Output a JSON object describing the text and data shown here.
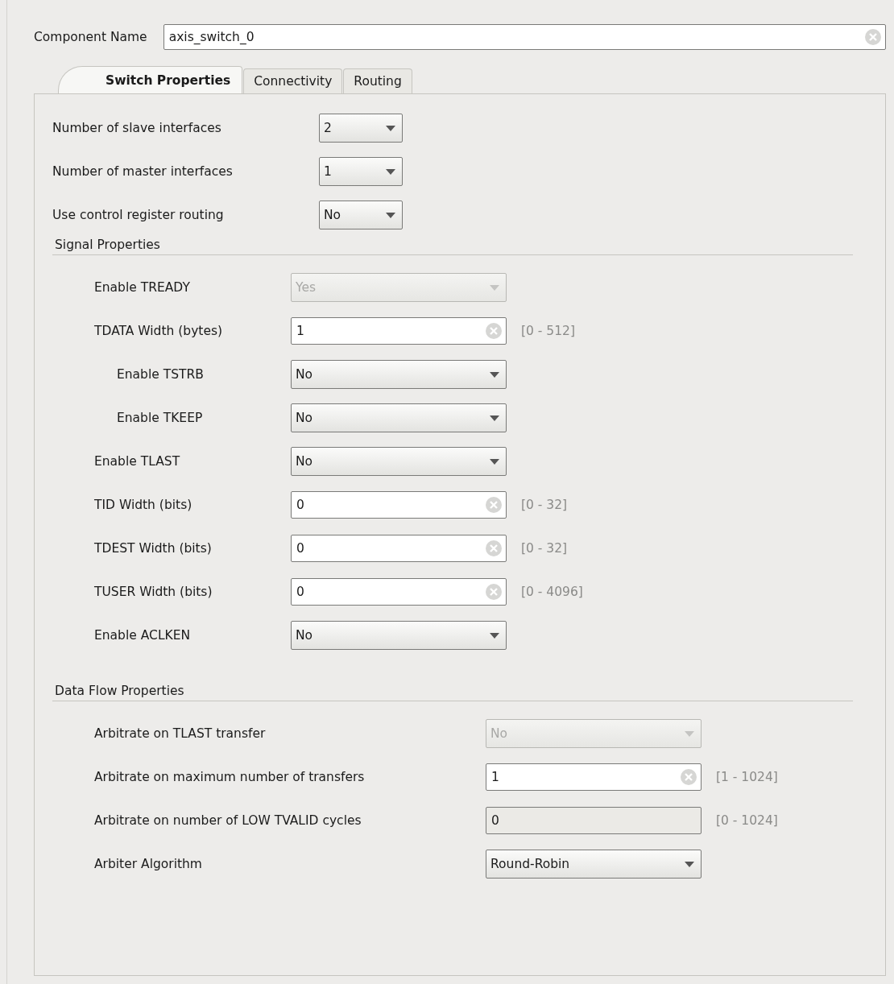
{
  "component_name": {
    "label": "Component Name",
    "value": "axis_switch_0"
  },
  "tabs": [
    {
      "label": "Switch Properties",
      "selected": true
    },
    {
      "label": "Connectivity",
      "selected": false
    },
    {
      "label": "Routing",
      "selected": false
    }
  ],
  "sections": [
    {
      "rows": [
        {
          "kind": "dropdown",
          "label": "Number of slave interfaces",
          "value": "2",
          "disabled": false
        },
        {
          "kind": "dropdown",
          "label": "Number of master interfaces",
          "value": "1",
          "disabled": false
        },
        {
          "kind": "dropdown",
          "label": "Use control register routing",
          "value": "No",
          "disabled": false
        }
      ]
    },
    {
      "title": "Signal Properties",
      "rows": [
        {
          "kind": "dropdown",
          "label": "Enable TREADY",
          "value": "Yes",
          "disabled": true
        },
        {
          "kind": "text",
          "label": "TDATA Width (bytes)",
          "value": "1",
          "disabled": false,
          "clearable": true,
          "range": "[0 - 512]",
          "children": [
            {
              "kind": "dropdown",
              "label": "Enable TSTRB",
              "value": "No",
              "disabled": false
            },
            {
              "kind": "dropdown",
              "label": "Enable TKEEP",
              "value": "No",
              "disabled": false
            }
          ]
        },
        {
          "kind": "dropdown",
          "label": "Enable TLAST",
          "value": "No",
          "disabled": false
        },
        {
          "kind": "text",
          "label": "TID Width (bits)",
          "value": "0",
          "disabled": false,
          "clearable": true,
          "range": "[0 - 32]"
        },
        {
          "kind": "text",
          "label": "TDEST Width (bits)",
          "value": "0",
          "disabled": false,
          "clearable": true,
          "range": "[0 - 32]"
        },
        {
          "kind": "text",
          "label": "TUSER Width (bits)",
          "value": "0",
          "disabled": false,
          "clearable": true,
          "range": "[0 - 4096]"
        },
        {
          "kind": "dropdown",
          "label": "Enable ACLKEN",
          "value": "No",
          "disabled": false
        }
      ]
    },
    {
      "title": "Data Flow Properties",
      "rows": [
        {
          "kind": "dropdown",
          "label": "Arbitrate on TLAST transfer",
          "value": "No",
          "disabled": true
        },
        {
          "kind": "text",
          "label": "Arbitrate on maximum number of transfers",
          "value": "1",
          "disabled": false,
          "clearable": true,
          "range": "[1 - 1024]"
        },
        {
          "kind": "text",
          "label": "Arbitrate on number of LOW TVALID cycles",
          "value": "0",
          "disabled": true,
          "clearable": false,
          "range": "[0 - 1024]"
        },
        {
          "kind": "dropdown",
          "label": "Arbiter Algorithm",
          "value": "Round-Robin",
          "disabled": false
        }
      ]
    }
  ]
}
